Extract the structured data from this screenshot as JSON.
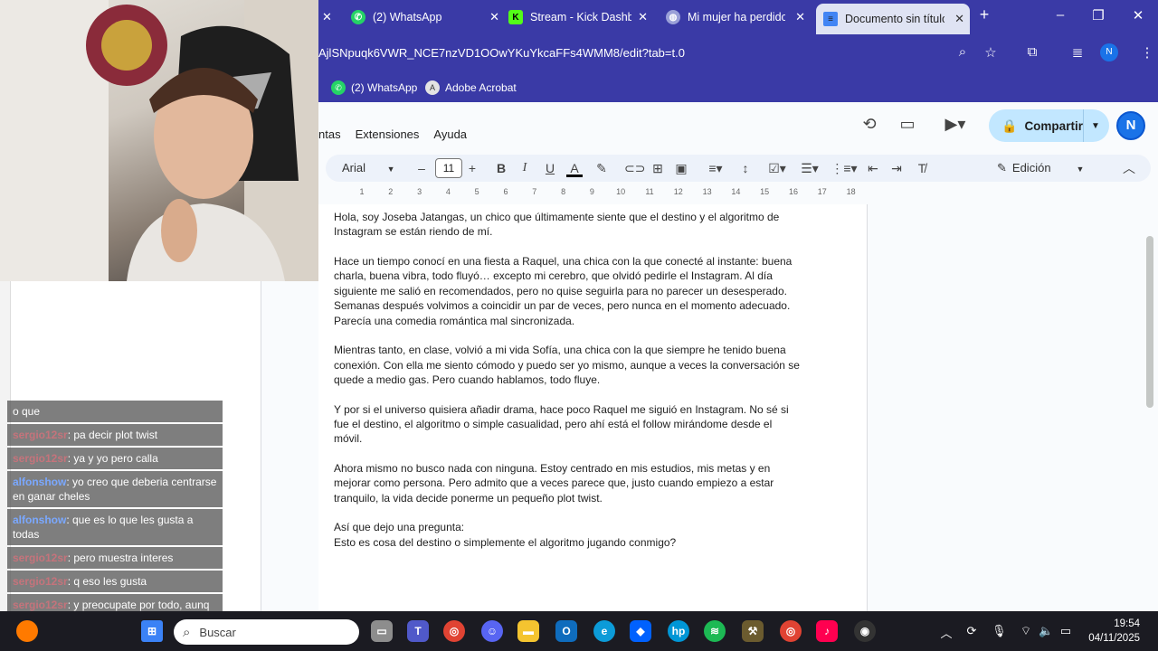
{
  "browser": {
    "tabs": [
      {
        "title": "(2) WhatsApp",
        "icon": "whatsapp-icon"
      },
      {
        "title": "Stream - Kick Dashbo",
        "icon": "kick-icon"
      },
      {
        "title": "Mi mujer ha perdido",
        "icon": "globe-icon"
      },
      {
        "title": "Documento sin título",
        "icon": "docs-icon"
      }
    ],
    "url": "AjlSNpuqk6VWR_NCE7nzVD1OOwYKuYkcaFFs4WMM8/edit?tab=t.0",
    "profile_initial": "N",
    "bookmarks": [
      {
        "label": "(2) WhatsApp",
        "icon": "whatsapp-icon"
      },
      {
        "label": "Adobe Acrobat",
        "icon": "acrobat-icon"
      }
    ]
  },
  "docs": {
    "menu": [
      "ntas",
      "Extensiones",
      "Ayuda"
    ],
    "share_label": "Compartir",
    "avatar_initial": "N",
    "toolbar": {
      "font": "Arial",
      "font_size": "11",
      "mode": "Edición"
    },
    "ruler_numbers": [
      "1",
      "2",
      "3",
      "4",
      "5",
      "6",
      "7",
      "8",
      "9",
      "10",
      "11",
      "12",
      "13",
      "14",
      "15",
      "16",
      "17",
      "18"
    ],
    "paragraphs": [
      "Hola, soy Joseba Jatangas, un chico que últimamente siente que el destino y el algoritmo de Instagram se están riendo de mí.",
      "Hace un tiempo conocí en una fiesta a Raquel, una chica con la que conecté al instante: buena charla, buena vibra, todo fluyó… excepto mi cerebro, que olvidó pedirle el Instagram. Al día siguiente me salió en recomendados, pero no quise seguirla para no parecer un desesperado. Semanas después volvimos a coincidir un par de veces, pero nunca en el momento adecuado. Parecía una comedia romántica mal sincronizada.",
      "Mientras tanto, en clase, volvió a mi vida Sofía, una chica con la que siempre he tenido buena conexión. Con ella me siento cómodo y puedo ser yo mismo, aunque a veces la conversación se quede a medio gas. Pero cuando hablamos, todo fluye.",
      "Y por si el universo quisiera añadir drama, hace poco Raquel me siguió en Instagram. No sé si fue el destino, el algoritmo o simple casualidad, pero ahí está el follow mirándome desde el móvil.",
      "Ahora mismo no busco nada con ninguna. Estoy centrado en mis estudios, mis metas y en mejorar como persona. Pero admito que a veces parece que, justo cuando empiezo a estar tranquilo, la vida decide ponerme un pequeño plot twist.",
      "Así que dejo una pregunta:"
    ],
    "last_line": "Esto es cosa del destino o simplemente el algoritmo jugando conmigo?"
  },
  "chat": [
    {
      "user": "",
      "text": "o que"
    },
    {
      "user": "sergio12sr",
      "text": ": pa decir plot twist"
    },
    {
      "user": "sergio12sr",
      "text": ": ya y yo pero calla"
    },
    {
      "user": "alfonshow",
      "text": ": yo creo que deberia centrarse en ganar cheles"
    },
    {
      "user": "alfonshow",
      "text": ": que es lo que les gusta a todas"
    },
    {
      "user": "sergio12sr",
      "text": ": pero muestra interes"
    },
    {
      "user": "sergio12sr",
      "text": ": q eso les gusta"
    },
    {
      "user": "sergio12sr",
      "text": ": y preocupate por todo, aunq no parezca importante"
    }
  ],
  "taskbar": {
    "search_placeholder": "Buscar",
    "time": "19:54",
    "date": "04/11/2025"
  },
  "colors": {
    "chrome_frame": "#3a3aa6",
    "share_button": "#c2e7ff",
    "accent_blue": "#1a73e8"
  }
}
